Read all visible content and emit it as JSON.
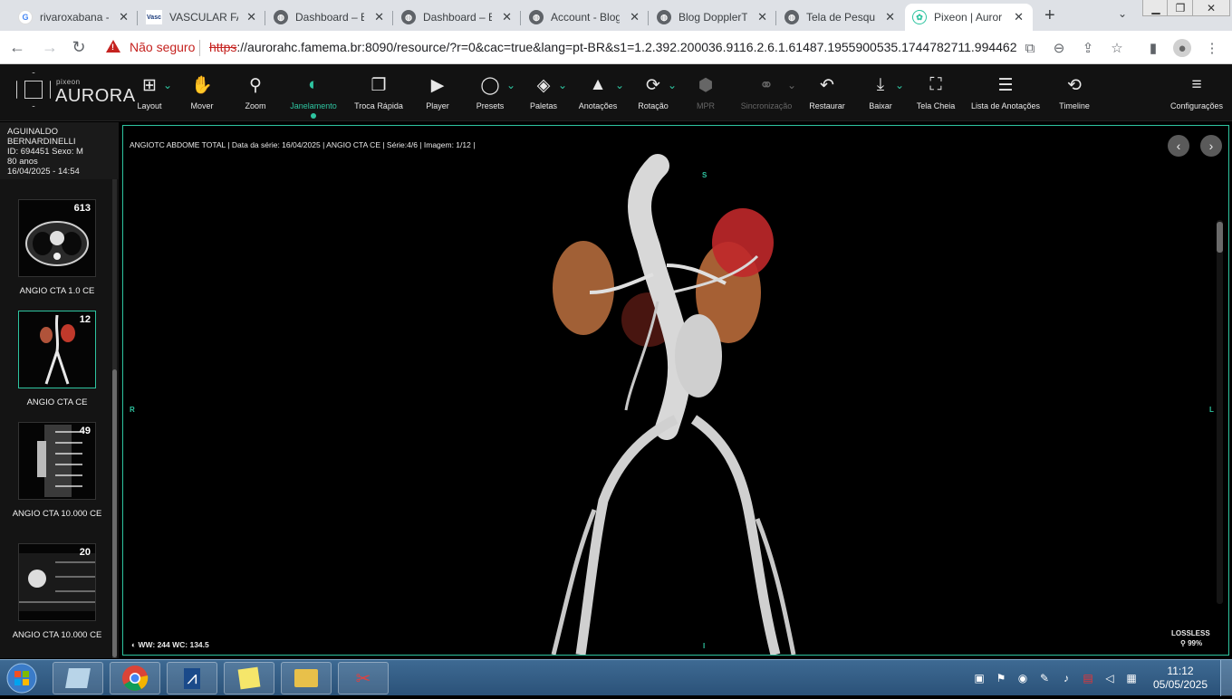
{
  "browser": {
    "tabs": [
      {
        "title": "rivaroxabana -",
        "favicon": "google-icon",
        "active": false
      },
      {
        "title": "VASCULAR FA",
        "favicon": "vasc-icon",
        "active": false
      },
      {
        "title": "Dashboard – B",
        "favicon": "globe-icon",
        "active": false
      },
      {
        "title": "Dashboard – B",
        "favicon": "globe-icon",
        "active": false
      },
      {
        "title": "Account - Blog",
        "favicon": "globe-icon",
        "active": false
      },
      {
        "title": "Blog DopplerT",
        "favicon": "globe-icon",
        "active": false
      },
      {
        "title": "Tela de Pesqui",
        "favicon": "globe-icon",
        "active": false
      },
      {
        "title": "Pixeon | Auror",
        "favicon": "pixeon-icon",
        "active": true
      }
    ],
    "vasc_favicon_text": "Vasc",
    "not_secure": "Não seguro",
    "url_https": "https",
    "url_rest": "://aurorahc.famema.br:8090/resource/?r=0&cac=true&lang=pt-BR&s1=1.2.392.200036.9116.2.6.1.61487.1955900535.1744782711.994462"
  },
  "app": {
    "logo_small": "pixeon",
    "logo_text": "AURORA",
    "toolbar": [
      {
        "label": "Layout",
        "icon": "layout-grid-icon",
        "chevron": true
      },
      {
        "label": "Mover",
        "icon": "hand-icon"
      },
      {
        "label": "Zoom",
        "icon": "search-icon"
      },
      {
        "label": "Janelamento",
        "icon": "contrast-icon",
        "active": true
      },
      {
        "label": "Troca Rápida",
        "icon": "copy-icon"
      },
      {
        "label": "Player",
        "icon": "play-icon"
      },
      {
        "label": "Presets",
        "icon": "presets-icon",
        "chevron": true
      },
      {
        "label": "Paletas",
        "icon": "palette-icon",
        "chevron": true
      },
      {
        "label": "Anotações",
        "icon": "shapes-icon",
        "chevron": true
      },
      {
        "label": "Rotação",
        "icon": "rotation-icon",
        "chevron": true
      },
      {
        "label": "MPR",
        "icon": "cube-icon",
        "disabled": true
      },
      {
        "label": "Sincronização",
        "icon": "link-icon",
        "disabled": true,
        "chevron": true
      },
      {
        "label": "Restaurar",
        "icon": "undo-icon"
      },
      {
        "label": "Baixar",
        "icon": "download-icon",
        "chevron": true
      },
      {
        "label": "Tela Cheia",
        "icon": "fullscreen-icon"
      },
      {
        "label": "Lista de Anotações",
        "icon": "list-icon"
      },
      {
        "label": "Timeline",
        "icon": "history-icon"
      },
      {
        "label": "Configurações",
        "icon": "menu-icon"
      }
    ]
  },
  "patient": {
    "name_line1": "AGUINALDO",
    "name_line2": "BERNARDINELLI",
    "id_sex": "ID: 694451  Sexo: M",
    "age": "80 anos",
    "date": "16/04/2025 - 14:54"
  },
  "series": [
    {
      "count": "613",
      "label": "ANGIO CTA 1.0 CE",
      "selected": false
    },
    {
      "count": "12",
      "label": "ANGIO CTA CE",
      "selected": true
    },
    {
      "count": "49",
      "label": "ANGIO CTA 10.000 CE",
      "selected": false
    },
    {
      "count": "20",
      "label": "ANGIO CTA 10.000 CE",
      "selected": false
    }
  ],
  "viewer": {
    "info": "ANGIOTC ABDOME TOTAL  |  Data da série: 16/04/2025  |  ANGIO CTA CE  |  Série:4/6  |  Imagem: 1/12  |",
    "orient_top": "S",
    "orient_bottom": "I",
    "orient_left": "R",
    "orient_right": "L",
    "wwwc": "WW: 244 WC: 134.5",
    "lossless": "LOSSLESS",
    "zoom": "99%"
  },
  "taskbar": {
    "time": "11:12",
    "date": "05/05/2025"
  },
  "colors": {
    "accent": "#2ec4a0",
    "not_secure": "#c5221f"
  }
}
